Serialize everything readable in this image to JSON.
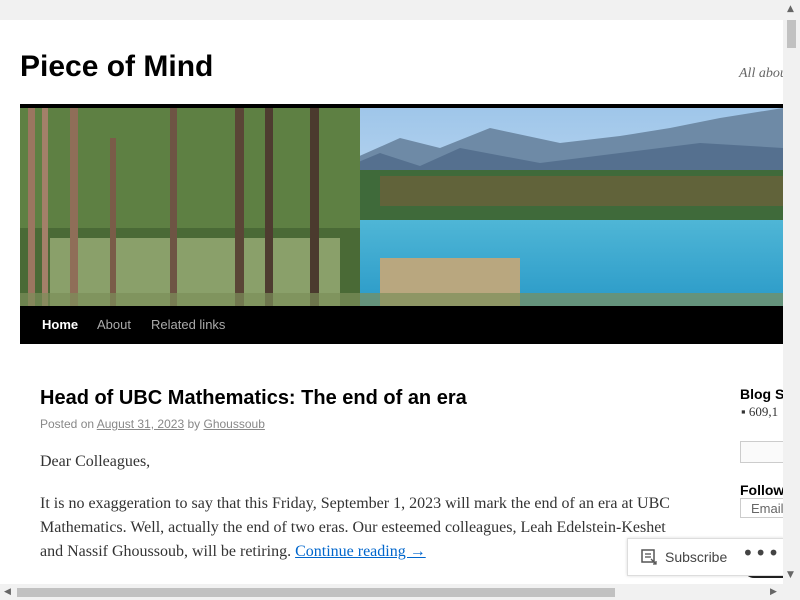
{
  "site": {
    "title": "Piece of Mind",
    "description": "All about"
  },
  "nav": {
    "items": [
      {
        "label": "Home",
        "active": true
      },
      {
        "label": "About",
        "active": false
      },
      {
        "label": "Related links",
        "active": false
      }
    ]
  },
  "post": {
    "title": "Head of UBC Mathematics: The end of an era",
    "posted_on": "Posted on",
    "date": "August 31, 2023",
    "by": "by",
    "author": "Ghoussoub",
    "greeting": "Dear Colleagues,",
    "paragraph": "It is no exaggeration to say that this Friday, September 1, 2023 will mark the end of an era at UBC Mathematics. Well, actually the end of two eras. Our esteemed colleagues, Leah Edelstein-Keshet and Nassif Ghoussoub, will be retiring.",
    "continue_reading": "Continue reading →"
  },
  "sidebar": {
    "blog_stats_title": "Blog S",
    "blog_stats_value": "609,1",
    "follow_title": "Follow",
    "email_placeholder": "Email"
  },
  "subscribe_bar": {
    "subscribe_label": "Subscribe",
    "more_label": "•••"
  },
  "colors": {
    "nav_background": "#000000",
    "link": "#0066cc",
    "page_background": "#ffffff"
  }
}
